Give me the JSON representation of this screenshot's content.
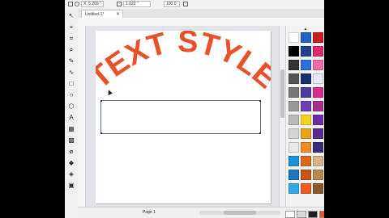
{
  "propbar": {
    "x_field": "X: 5.269 \"",
    "y_field": "1.022 \"",
    "zoom_field": "100.0"
  },
  "document": {
    "tab_label": "Untitled-1*",
    "tab_close": "✕"
  },
  "canvas": {
    "art_text": "TEXT STYLE",
    "art_color": "#e8522a"
  },
  "status": {
    "page_label": "Page 1"
  },
  "tools": [
    "pick-icon",
    "shape-icon",
    "crop-icon",
    "zoom-icon",
    "freehand-icon",
    "artistic-media-icon",
    "rectangle-icon",
    "ellipse-icon",
    "polygon-icon",
    "text-icon",
    "table-icon",
    "pattern-icon",
    "eyedropper-icon",
    "fill-icon",
    "interactive-fill-icon",
    "smart-fill-icon"
  ],
  "palette": [
    [
      "#ffffff",
      "#1e63c8",
      "#c81e1e"
    ],
    [
      "#000000",
      "#1f3f8f",
      "#e0296e"
    ],
    [
      "#333333",
      "#2f6fd8",
      "#f06ca8"
    ],
    [
      "#555555",
      "#1b2f6e",
      "#e8e8f4"
    ],
    [
      "#777777",
      "#4e3a9e",
      "#d62b8a"
    ],
    [
      "#999999",
      "#6e3fb2",
      "#a8308e"
    ],
    [
      "#bbbbbb",
      "#f4d21f",
      "#6a2fa6"
    ],
    [
      "#d5d5d5",
      "#e8a21b",
      "#5a2a96"
    ],
    [
      "#e8e8e8",
      "#f08a24",
      "#3a2a7e"
    ],
    [
      "#1e90d8",
      "#d86a1e",
      "#d8b48a"
    ],
    [
      "#1a78c2",
      "#c4561a",
      "#b88a4e"
    ],
    [
      "#2fa8e8",
      "#f05a1e",
      "#8a5a2a"
    ]
  ],
  "status_swatches": [
    "#ffffff",
    "#d9d9d9",
    "#1e1e1e",
    "#e8522a"
  ]
}
